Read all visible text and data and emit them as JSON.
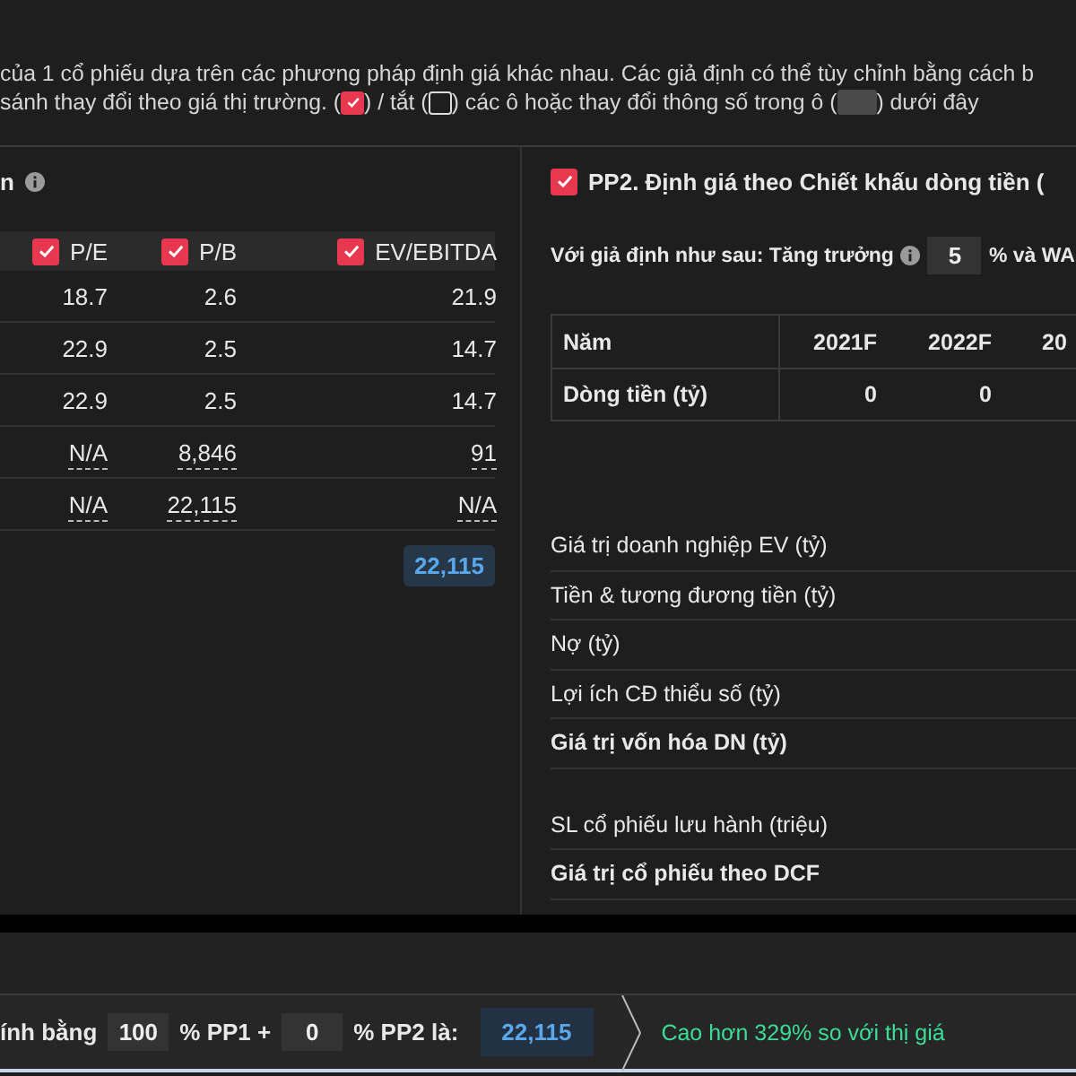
{
  "intro": {
    "line_1": "của 1 cổ phiếu dựa trên các phương pháp định giá khác nhau. Các giả định có thể tùy chỉnh bằng cách b",
    "line_2": [
      {
        "kind": "text",
        "text": "sánh thay đổi theo giá thị trường. ("
      },
      {
        "kind": "checkbox",
        "checked": true
      },
      {
        "kind": "text",
        "text": ") / tắt ("
      },
      {
        "kind": "checkbox",
        "checked": false
      },
      {
        "kind": "text",
        "text": ") các ô hoặc thay đổi thông số trong ô ("
      },
      {
        "kind": "swatch"
      },
      {
        "kind": "text",
        "text": ") dưới đây"
      }
    ]
  },
  "pp1": {
    "title": "n",
    "columns": [
      {
        "label": "P/E",
        "checked": true
      },
      {
        "label": "P/B",
        "checked": true
      },
      {
        "label": "EV/EBITDA",
        "checked": true
      }
    ],
    "rows": [
      {
        "linked": false,
        "cells": [
          "18.7",
          "2.6",
          "21.9"
        ]
      },
      {
        "linked": false,
        "cells": [
          "22.9",
          "2.5",
          "14.7"
        ]
      },
      {
        "linked": false,
        "cells": [
          "22.9",
          "2.5",
          "14.7"
        ]
      },
      {
        "linked": true,
        "cells": [
          "N/A",
          "8,846",
          "91"
        ]
      },
      {
        "linked": true,
        "cells": [
          "N/A",
          "22,115",
          "N/A"
        ]
      }
    ],
    "total": "22,115"
  },
  "pp2": {
    "title": "PP2. Định giá theo Chiết khấu dòng tiền (",
    "checked": true,
    "assumption_label": "Với giả định như sau: Tăng trưởng",
    "growth": "5",
    "after": "% và WA",
    "table": {
      "header": [
        "Năm",
        "2021F",
        "2022F",
        "20"
      ],
      "rows": [
        [
          "Dòng tiền (tỷ)",
          "0",
          "0",
          ""
        ]
      ]
    },
    "items": [
      {
        "label": "Giá trị doanh nghiệp EV (tỷ)",
        "bold": false,
        "gap_before": false
      },
      {
        "label": "Tiền & tương đương tiền (tỷ)",
        "bold": false,
        "gap_before": false
      },
      {
        "label": "Nợ (tỷ)",
        "bold": false,
        "gap_before": false
      },
      {
        "label": "Lợi ích CĐ thiểu số (tỷ)",
        "bold": false,
        "gap_before": false
      },
      {
        "label": "Giá trị vốn hóa DN (tỷ)",
        "bold": true,
        "gap_before": false
      },
      {
        "label": "SL cổ phiếu lưu hành (triệu)",
        "bold": false,
        "gap_before": true
      },
      {
        "label": "Giá trị cổ phiếu theo DCF",
        "bold": true,
        "gap_before": false
      }
    ]
  },
  "summary": {
    "lead": "ính bằng",
    "pp1_weight": "100",
    "pp1_label": "% PP1 +",
    "pp2_weight": "0",
    "pp2_label": "% PP2 là:",
    "result": "22,115",
    "comparison": "Cao hơn 329% so với thị giá"
  }
}
